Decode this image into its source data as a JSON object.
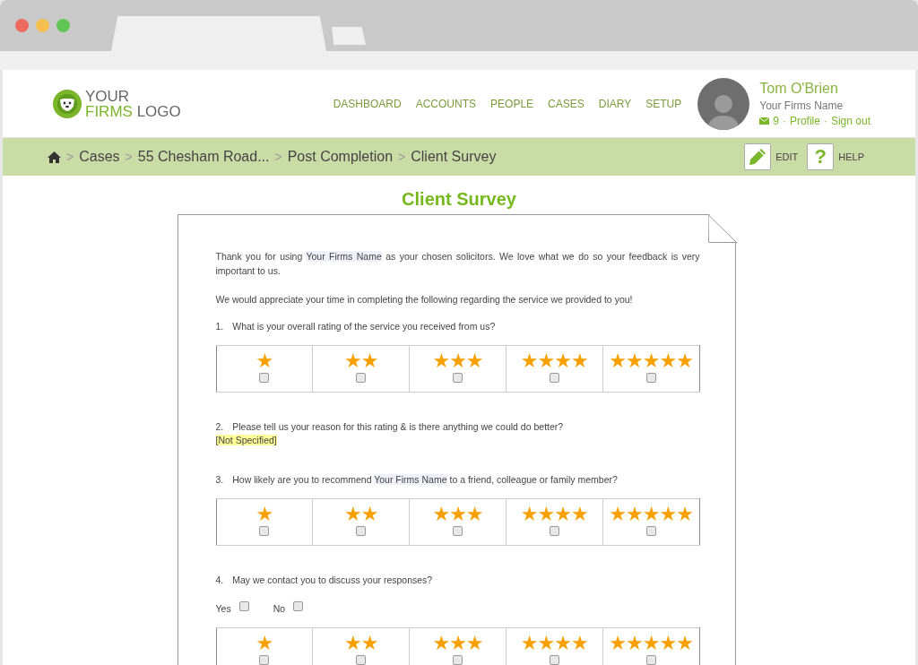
{
  "logo": {
    "line_1": "YOUR",
    "line_2_accent": "FIRMS",
    "line_2": "LOGO"
  },
  "nav": [
    "DASHBOARD",
    "ACCOUNTS",
    "PEOPLE",
    "CASES",
    "DIARY",
    "SETUP"
  ],
  "user": {
    "name": "Tom O'Brien",
    "firm": "Your Firms Name",
    "messages": "9",
    "separator": "·",
    "links": [
      "Profile",
      "Sign out"
    ]
  },
  "breadcrumb": {
    "separator": ">",
    "items": [
      "Cases",
      "55 Chesham Road...",
      "Post Completion",
      "Client Survey"
    ]
  },
  "actions": [
    {
      "kind": "edit",
      "label": "EDIT"
    },
    {
      "kind": "help",
      "glyph": "?",
      "label": "HELP"
    }
  ],
  "survey": {
    "title": "Client Survey",
    "intro": [
      {
        "text": "Thank you for using "
      },
      {
        "text": "Your Firms Name",
        "kind": "merge_field"
      },
      {
        "text": " as your chosen solicitors. We love what we do so your feedback is very important to us."
      }
    ],
    "intro_2": "We would appreciate your time in completing the following regarding the service we provided to you!",
    "questions": [
      {
        "kind": "rating",
        "number": "1.",
        "text": [
          {
            "text": "What is your overall rating of the service you received from us?"
          }
        ],
        "options": [
          {
            "label": "★",
            "checked": false
          },
          {
            "label": "★★",
            "checked": false
          },
          {
            "label": "★★★",
            "checked": false
          },
          {
            "label": "★★★★",
            "checked": false
          },
          {
            "label": "★★★★★",
            "checked": false
          }
        ]
      },
      {
        "kind": "text",
        "number": "2.",
        "text": [
          {
            "text": "Please tell us your reason for this rating & is there anything we could do better?"
          }
        ],
        "answer": "[Not Specified]"
      },
      {
        "kind": "rating",
        "number": "3.",
        "text": [
          {
            "text": "How likely are you to recommend "
          },
          {
            "text": "Your Firms Name",
            "kind": "merge_field"
          },
          {
            "text": " to a friend, colleague or family member?"
          }
        ],
        "options": [
          {
            "label": "★",
            "checked": false
          },
          {
            "label": "★★",
            "checked": false
          },
          {
            "label": "★★★",
            "checked": false
          },
          {
            "label": "★★★★",
            "checked": false
          },
          {
            "label": "★★★★★",
            "checked": false
          }
        ]
      },
      {
        "kind": "yes_no",
        "number": "4.",
        "text": [
          {
            "text": "May we contact you to discuss your responses?"
          }
        ],
        "options": [
          {
            "label": "Yes",
            "checked": false
          },
          {
            "label": "No",
            "checked": false
          }
        ]
      },
      {
        "kind": "rating",
        "options": [
          {
            "label": "★",
            "checked": false
          },
          {
            "label": "★★",
            "checked": false
          },
          {
            "label": "★★★",
            "checked": false
          },
          {
            "label": "★★★★",
            "checked": false
          },
          {
            "label": "★★★★★",
            "checked": false
          }
        ]
      }
    ]
  }
}
